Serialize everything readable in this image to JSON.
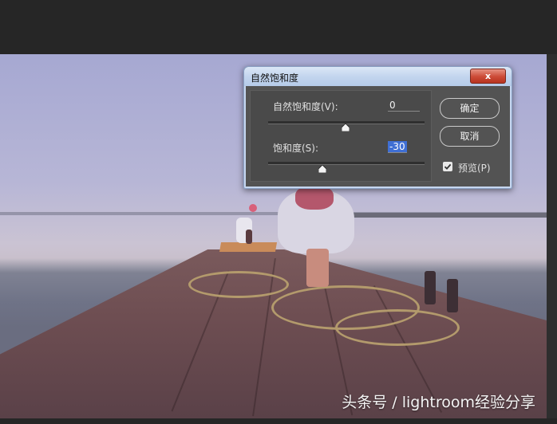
{
  "dialog": {
    "title": "自然饱和度",
    "close_label": "x",
    "vibrance": {
      "label": "自然饱和度(V):",
      "value": "0",
      "level": 0
    },
    "saturation": {
      "label": "饱和度(S):",
      "value": "-30",
      "level": -30
    },
    "ok_label": "确定",
    "cancel_label": "取消",
    "preview": {
      "label": "预览(P)",
      "checked": true
    }
  },
  "watermark": "头条号 / lightroom经验分享",
  "colors": {
    "dialog_bg": "#535353",
    "titlebar": "#c3d5ee",
    "close_button": "#cc4a36",
    "selection": "#3f6fd4"
  },
  "icons": [
    "close-icon",
    "slider-thumb-icon",
    "checkmark-icon"
  ]
}
